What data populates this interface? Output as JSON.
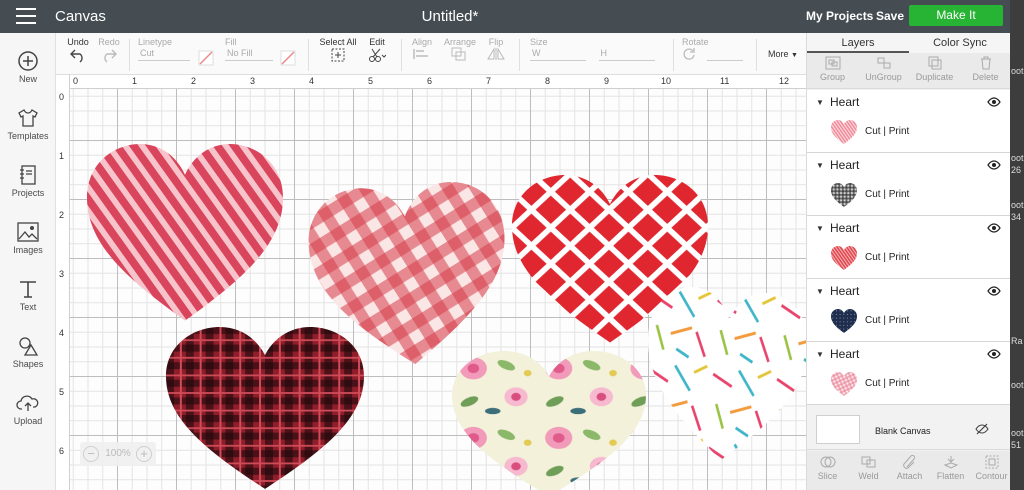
{
  "colors": {
    "topbar": "#454d53",
    "accent": "#27b333",
    "sidebar": "#f6f6f6",
    "panel": "#f2f2f2"
  },
  "topbar": {
    "menu_icon": "hamburger-icon",
    "app_title": "Canvas",
    "doc_title": "Untitled*",
    "my_projects": "My Projects",
    "save": "Save",
    "make_it": "Make It"
  },
  "sidebar": {
    "items": [
      {
        "label": "New",
        "icon": "plus-circle-icon"
      },
      {
        "label": "Templates",
        "icon": "tshirt-icon"
      },
      {
        "label": "Projects",
        "icon": "notebook-icon"
      },
      {
        "label": "Images",
        "icon": "image-icon"
      },
      {
        "label": "Text",
        "icon": "text-t-icon"
      },
      {
        "label": "Shapes",
        "icon": "shapes-icon"
      },
      {
        "label": "Upload",
        "icon": "cloud-upload-icon"
      }
    ]
  },
  "toolbar": {
    "undo": "Undo",
    "redo": "Redo",
    "linetype": "Linetype",
    "linetype_value": "Cut",
    "fill": "Fill",
    "fill_value": "No Fill",
    "select_all": "Select All",
    "edit": "Edit",
    "align": "Align",
    "arrange": "Arrange",
    "flip": "Flip",
    "size": "Size",
    "size_w": "W",
    "size_h": "H",
    "rotate": "Rotate",
    "more": "More"
  },
  "ruler": {
    "top": [
      "0",
      "1",
      "2",
      "3",
      "4",
      "5",
      "6",
      "7",
      "8",
      "9",
      "10",
      "11",
      "12"
    ],
    "left": [
      "0",
      "1",
      "2",
      "3",
      "4",
      "5",
      "6"
    ]
  },
  "zoom": {
    "value": "100%",
    "minus": "−",
    "plus": "+"
  },
  "panel": {
    "tabs": [
      "Layers",
      "Color Sync"
    ],
    "actions": [
      "Group",
      "UnGroup",
      "Duplicate",
      "Delete"
    ],
    "layers": [
      {
        "name": "Heart",
        "ops": "Cut  | Print",
        "pattern": "pink-stripes"
      },
      {
        "name": "Heart",
        "ops": "Cut  | Print",
        "pattern": "black-gingham"
      },
      {
        "name": "Heart",
        "ops": "Cut  | Print",
        "pattern": "red-stripes"
      },
      {
        "name": "Heart",
        "ops": "Cut  | Print",
        "pattern": "navy-dots"
      },
      {
        "name": "Heart",
        "ops": "Cut  | Print",
        "pattern": "pink-gingham"
      }
    ],
    "blank_canvas": "Blank Canvas",
    "bottom_actions": [
      "Slice",
      "Weld",
      "Attach",
      "Flatten",
      "Contour"
    ]
  },
  "edge_text": [
    "oot",
    "oot",
    "26",
    "oot",
    "34",
    "Ra",
    "oot",
    "oot",
    "51"
  ]
}
